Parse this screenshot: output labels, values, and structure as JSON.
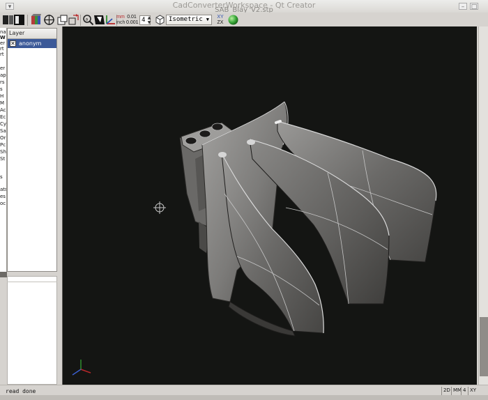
{
  "window": {
    "title": "CadConverterWorkspace - Qt Creator",
    "file_name": "SAB_Blay_V2.stp"
  },
  "toolbar": {
    "units_label_top": "mm",
    "units_label_bottom": "inch",
    "precision_top": "0.01",
    "precision_bottom": "0.001",
    "spin_value": "4",
    "view_mode": "Isometric",
    "plane_top": "XY",
    "plane_bottom": "ZX"
  },
  "left_strip": {
    "labels": [
      "na",
      "W",
      "er",
      "rt",
      "rt",
      "er",
      "ap",
      "rs",
      "s",
      "H",
      "M",
      "Ac",
      "Ec",
      "Cy",
      "Sa",
      "Or",
      "Pc",
      "Sh",
      "St",
      "s",
      "ats",
      "es",
      "oc"
    ]
  },
  "layer_panel": {
    "header": "Layer",
    "layers": [
      {
        "name": "anonym",
        "visible": true
      }
    ]
  },
  "status": {
    "message": "read done",
    "mode_2d": "2D",
    "units": "MM",
    "precision": "4",
    "plane": "XY"
  },
  "colors": {
    "viewport_bg": "#141513",
    "model_body": "#8b8a88",
    "selection": "#3b5998",
    "accent_green": "#3aa83a"
  },
  "icons": {
    "app_menu": "app-menu-icon",
    "panels": "panels-icon",
    "color_cube": "color-cube-icon",
    "target": "target-icon",
    "display_mode": "display-mode-icon",
    "move": "move-icon",
    "zoom_fit": "zoom-fit-icon",
    "shading": "shading-icon",
    "axes": "axes-icon",
    "cube": "cube-icon",
    "render": "render-sphere-icon"
  }
}
